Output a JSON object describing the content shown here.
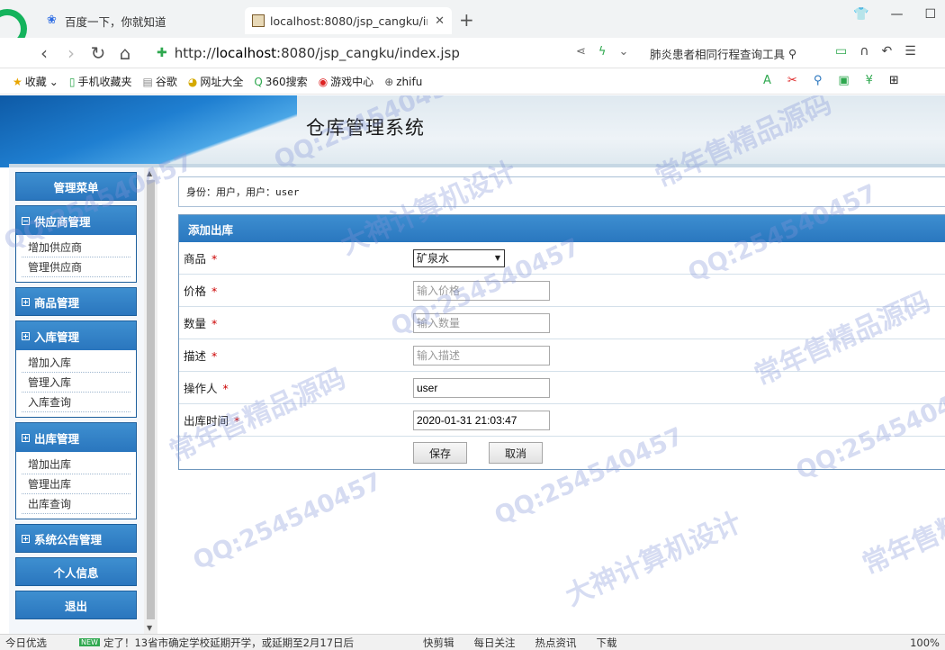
{
  "browser": {
    "tabs": [
      {
        "title": "百度一下，你就知道",
        "active": false
      },
      {
        "title": "localhost:8080/jsp_cangku/inc",
        "active": true
      }
    ],
    "url_prefix": "http://",
    "url_host": "localhost",
    "url_rest": ":8080/jsp_cangku/index.jsp",
    "search_text": "肺炎患者相同行程查询工具",
    "bookmarks": [
      "收藏",
      "手机收藏夹",
      "谷歌",
      "网址大全",
      "360搜索",
      "游戏中心",
      "zhifu"
    ]
  },
  "site": {
    "title": "仓库管理系统"
  },
  "sidebar": {
    "header": "管理菜单",
    "groups": [
      {
        "title": "供应商管理",
        "expanded": true,
        "items": [
          "增加供应商",
          "管理供应商"
        ]
      },
      {
        "title": "商品管理",
        "expanded": false,
        "items": []
      },
      {
        "title": "入库管理",
        "expanded": true,
        "items": [
          "增加入库",
          "管理入库",
          "入库查询"
        ]
      },
      {
        "title": "出库管理",
        "expanded": true,
        "items": [
          "增加出库",
          "管理出库",
          "出库查询"
        ]
      },
      {
        "title": "系统公告管理",
        "expanded": false,
        "items": []
      }
    ],
    "personal_info": "个人信息",
    "logout": "退出"
  },
  "identity": "身份：用户，用户：user",
  "form": {
    "title": "添加出库",
    "fields": {
      "product": {
        "label": "商品",
        "value": "矿泉水"
      },
      "price": {
        "label": "价格",
        "placeholder": "输入价格"
      },
      "quantity": {
        "label": "数量",
        "placeholder": "输入数量"
      },
      "description": {
        "label": "描述",
        "placeholder": "输入描述"
      },
      "operator": {
        "label": "操作人",
        "value": "user"
      },
      "time": {
        "label": "出库时间",
        "value": "2020-01-31 21:03:47"
      }
    },
    "required_mark": "*",
    "save": "保存",
    "cancel": "取消"
  },
  "statusbar": {
    "left": "今日优选",
    "badge": "NEW",
    "news": "定了！13省市确定学校延期开学，或延期至2月17日后",
    "items": [
      "快剪辑",
      "每日关注",
      "热点资讯",
      "下载"
    ],
    "zoom": "100%"
  },
  "watermark": {
    "qq": "QQ:254540457",
    "shop": "常年售精品源码",
    "design": "大神计算机设计"
  },
  "colors": {
    "menu_blue": "#2a76be",
    "required_red": "#cc0000",
    "watermark": "#8296d7"
  }
}
